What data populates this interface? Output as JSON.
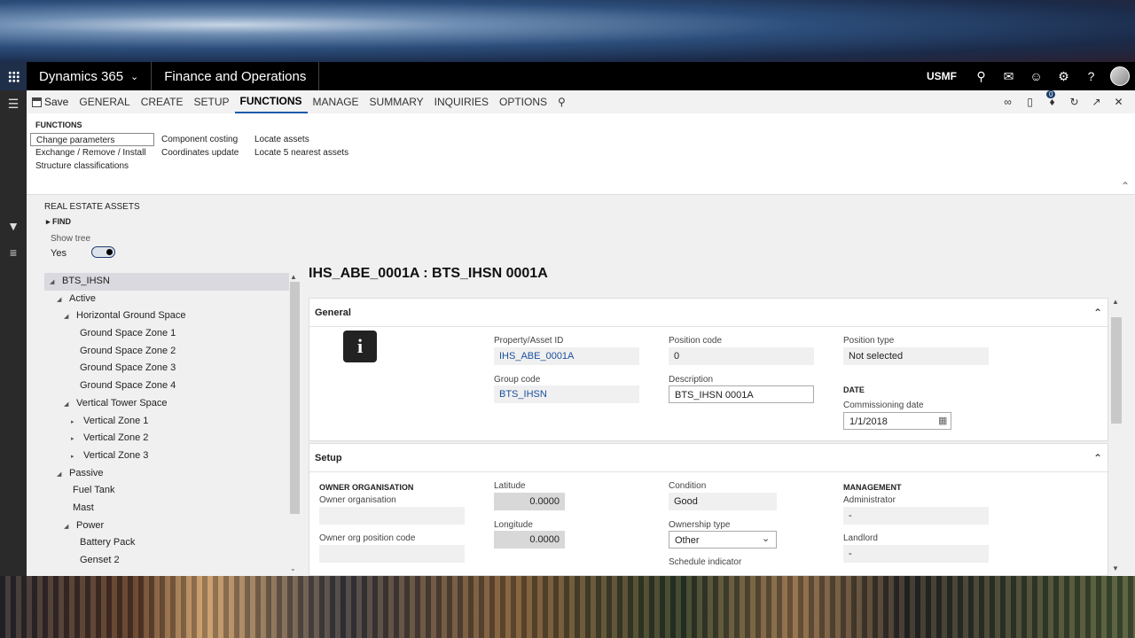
{
  "navbar": {
    "app_name": "Dynamics 365",
    "module": "Finance and Operations",
    "company": "USMF"
  },
  "actionpane": {
    "save_label": "Save",
    "tabs": [
      "GENERAL",
      "CREATE",
      "SETUP",
      "FUNCTIONS",
      "MANAGE",
      "SUMMARY",
      "INQUIRIES",
      "OPTIONS"
    ],
    "active_tab": "FUNCTIONS",
    "badge_count": "0"
  },
  "ribbon": {
    "group_title": "FUNCTIONS",
    "col1": [
      "Change parameters",
      "Exchange / Remove / Install",
      "Structure classifications"
    ],
    "col2": [
      "Component costing",
      "Coordinates update"
    ],
    "col3": [
      "Locate assets",
      "Locate 5 nearest assets"
    ]
  },
  "tree_panel": {
    "title": "REAL ESTATE ASSETS",
    "find": "FIND",
    "show_tree_label": "Show tree",
    "show_tree_value": "Yes",
    "nodes": [
      {
        "label": "BTS_IHSN",
        "level": 0,
        "arrow": "expanded"
      },
      {
        "label": "Active",
        "level": 1,
        "arrow": "expanded"
      },
      {
        "label": "Horizontal Ground Space",
        "level": 2,
        "arrow": "expanded"
      },
      {
        "label": "Ground Space Zone 1",
        "level": 3,
        "arrow": "none"
      },
      {
        "label": "Ground Space Zone 2",
        "level": 3,
        "arrow": "none"
      },
      {
        "label": "Ground Space Zone 3",
        "level": 3,
        "arrow": "none"
      },
      {
        "label": "Ground Space Zone 4",
        "level": 3,
        "arrow": "none"
      },
      {
        "label": "Vertical Tower Space",
        "level": 2,
        "arrow": "expanded"
      },
      {
        "label": "Vertical Zone 1",
        "level": 3,
        "arrow": "collapsed"
      },
      {
        "label": "Vertical Zone 2",
        "level": 3,
        "arrow": "collapsed"
      },
      {
        "label": "Vertical Zone 3",
        "level": 3,
        "arrow": "collapsed"
      },
      {
        "label": "Passive",
        "level": 1,
        "arrow": "expanded"
      },
      {
        "label": "Fuel Tank",
        "level": 2,
        "arrow": "none"
      },
      {
        "label": "Mast",
        "level": 2,
        "arrow": "none"
      },
      {
        "label": "Power",
        "level": 2,
        "arrow": "expanded"
      },
      {
        "label": "Battery Pack",
        "level": 3,
        "arrow": "none"
      },
      {
        "label": "Genset 2",
        "level": 3,
        "arrow": "none"
      }
    ]
  },
  "form": {
    "title": "IHS_ABE_0001A : BTS_IHSN 0001A",
    "general": {
      "header": "General",
      "property_id_label": "Property/Asset ID",
      "property_id": "IHS_ABE_0001A",
      "group_code_label": "Group code",
      "group_code": "BTS_IHSN",
      "position_code_label": "Position code",
      "position_code": "0",
      "description_label": "Description",
      "description": "BTS_IHSN 0001A",
      "position_type_label": "Position type",
      "position_type": "Not selected",
      "date_head": "DATE",
      "commissioning_label": "Commissioning date",
      "commissioning_date": "1/1/2018"
    },
    "setup": {
      "header": "Setup",
      "owner_head": "OWNER ORGANISATION",
      "owner_org_label": "Owner organisation",
      "owner_org": "",
      "owner_pos_label": "Owner org position code",
      "owner_pos": "",
      "latitude_label": "Latitude",
      "latitude": "0.0000",
      "longitude_label": "Longitude",
      "longitude": "0.0000",
      "condition_label": "Condition",
      "condition": "Good",
      "ownership_label": "Ownership type",
      "ownership": "Other",
      "schedule_label": "Schedule indicator",
      "management_head": "MANAGEMENT",
      "administrator_label": "Administrator",
      "administrator": "-",
      "landlord_label": "Landlord",
      "landlord": "-"
    }
  }
}
